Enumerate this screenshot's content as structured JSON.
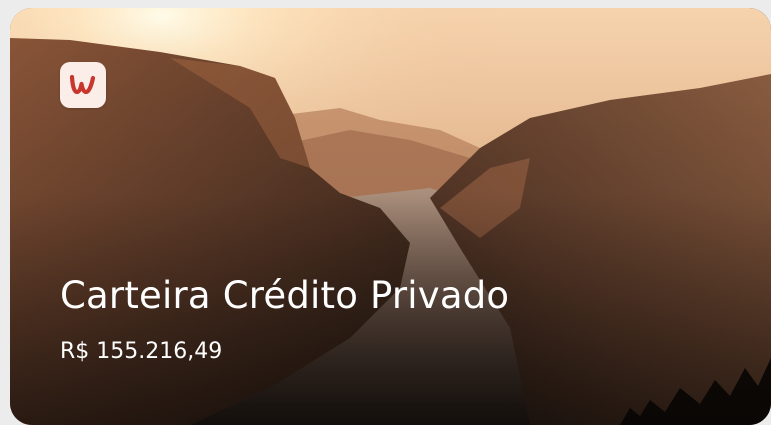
{
  "card": {
    "logo_icon": "brand-w-logo-icon",
    "logo_accent": "#c8372d",
    "title": "Carteira Crédito Privado",
    "amount": "R$ 155.216,49"
  }
}
